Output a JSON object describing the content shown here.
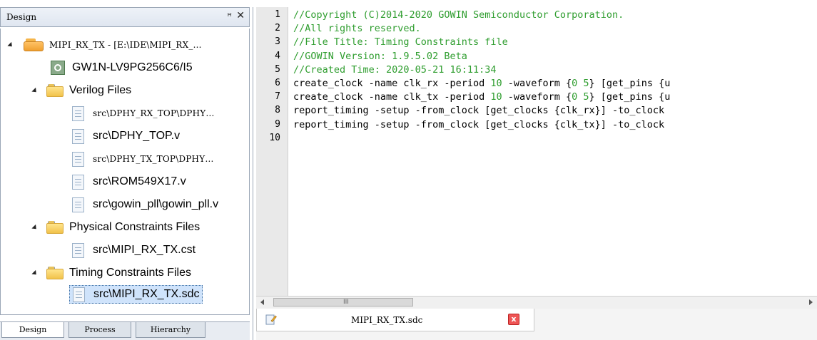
{
  "design_panel": {
    "title": "Design",
    "pin_glyph": "ꟸ",
    "close_glyph": "✕",
    "tree": {
      "project": "MIPI_RX_TX - [E:\\IDE\\MIPI_RX_…",
      "device": "GW1N-LV9PG256C6/I5",
      "verilog_folder": "Verilog Files",
      "verilog_files": [
        "src\\DPHY_RX_TOP\\DPHY…",
        "src\\DPHY_TOP.v",
        "src\\DPHY_TX_TOP\\DPHY…",
        "src\\ROM549X17.v",
        "src\\gowin_pll\\gowin_pll.v"
      ],
      "physical_folder": "Physical Constraints Files",
      "physical_files": [
        "src\\MIPI_RX_TX.cst"
      ],
      "timing_folder": "Timing Constraints Files",
      "timing_files": [
        "src\\MIPI_RX_TX.sdc"
      ]
    },
    "bottom_tabs": [
      "Design",
      "Process",
      "Hierarchy"
    ],
    "active_bottom_tab": "Design"
  },
  "editor": {
    "line_numbers": [
      "1",
      "2",
      "3",
      "4",
      "5",
      "6",
      "7",
      "8",
      "9",
      "10"
    ],
    "lines": [
      "//Copyright (C)2014-2020 GOWIN Semiconductor Corporation.",
      "//All rights reserved.",
      "//File Title: Timing Constraints file",
      "//GOWIN Version: 1.9.5.02 Beta",
      "//Created Time: 2020-05-21 16:11:34",
      [
        "create_clock -name clk_rx -period ",
        "10",
        " -waveform {",
        "0 5",
        "} [get_pins {u"
      ],
      [
        "create_clock -name clk_tx -period ",
        "10",
        " -waveform {",
        "0 5",
        "} [get_pins {u"
      ],
      "report_timing -setup -from_clock [get_clocks {clk_rx}] -to_clock",
      "report_timing -setup -from_clock [get_clocks {clk_tx}] -to_clock",
      ""
    ],
    "scroll_grip": "III",
    "doc_tab": {
      "label": "MIPI_RX_TX.sdc",
      "close_glyph": "x"
    }
  },
  "colors": {
    "comment": "#2e9d2e",
    "selection": "#cfe3fb",
    "folder": "#f1c24a"
  }
}
